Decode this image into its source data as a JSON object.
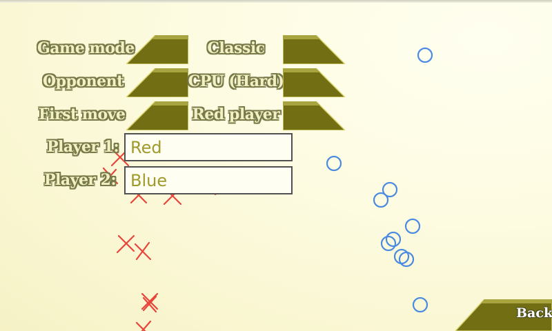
{
  "settings": {
    "game_mode": {
      "label": "Game mode",
      "value": "Classic"
    },
    "opponent": {
      "label": "Opponent",
      "value": "CPU (Hard)"
    },
    "first_move": {
      "label": "First move",
      "value": "Red player"
    },
    "player1": {
      "label": "Player 1:",
      "value": "Red"
    },
    "player2": {
      "label": "Player 2:",
      "value": "Blue"
    }
  },
  "back_label": "Back",
  "colors": {
    "button_dark": "#6e6a12",
    "button_light": "#c8c45a",
    "label_fill": "#f2f0c4",
    "label_outline": "#777a48",
    "cross": "#e8443a",
    "circle": "#4a8ae0"
  },
  "icons": [
    "prev-arrow-icon",
    "next-arrow-icon",
    "cross-mark-icon",
    "circle-mark-icon"
  ]
}
